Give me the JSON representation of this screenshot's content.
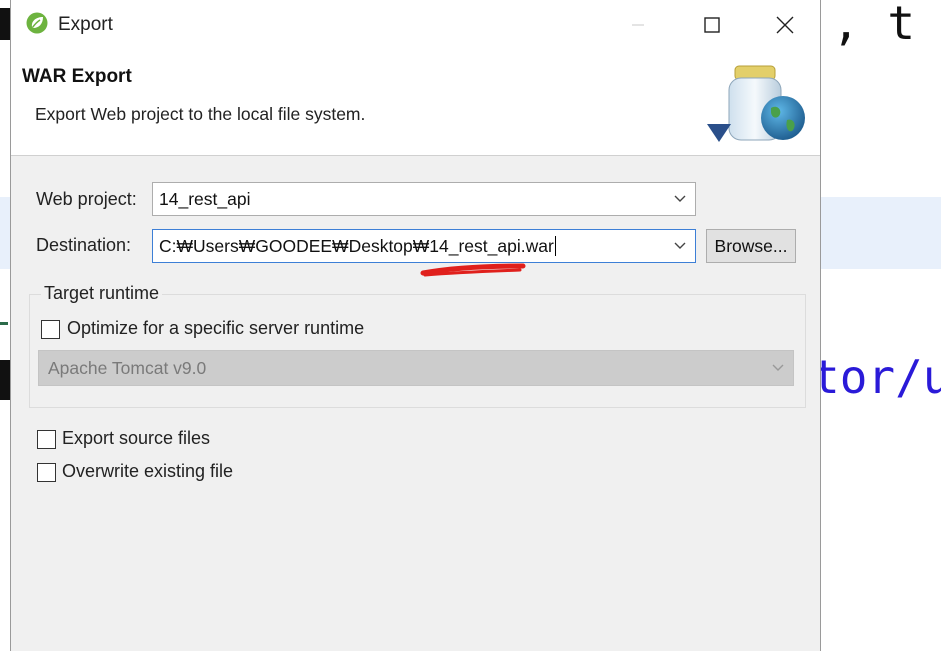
{
  "background_editor": {
    "code_line_top": ", t",
    "code_line_mid": "tor/u"
  },
  "window": {
    "title": "Export",
    "app_icon": "spring-leaf-icon",
    "controls": [
      "minimize-icon",
      "maximize-icon",
      "close-icon"
    ]
  },
  "header": {
    "title": "WAR Export",
    "description": "Export Web project to the local file system.",
    "image": "jar-globe-icon"
  },
  "form": {
    "web_project_label": "Web project:",
    "web_project_value": "14_rest_api",
    "destination_label": "Destination:",
    "destination_value": "C:₩Users₩GOODEE₩Desktop₩14_rest_api.war",
    "browse_label": "Browse..."
  },
  "target_runtime": {
    "legend": "Target runtime",
    "optimize_label": "Optimize for a specific server runtime",
    "optimize_checked": false,
    "runtime_value": "Apache Tomcat v9.0",
    "runtime_enabled": false
  },
  "options": {
    "export_source_label": "Export source files",
    "export_source_checked": false,
    "overwrite_label": "Overwrite existing file",
    "overwrite_checked": false
  },
  "colors": {
    "annotation_red": "#e0201c",
    "focus_border": "#3d7fd6"
  }
}
